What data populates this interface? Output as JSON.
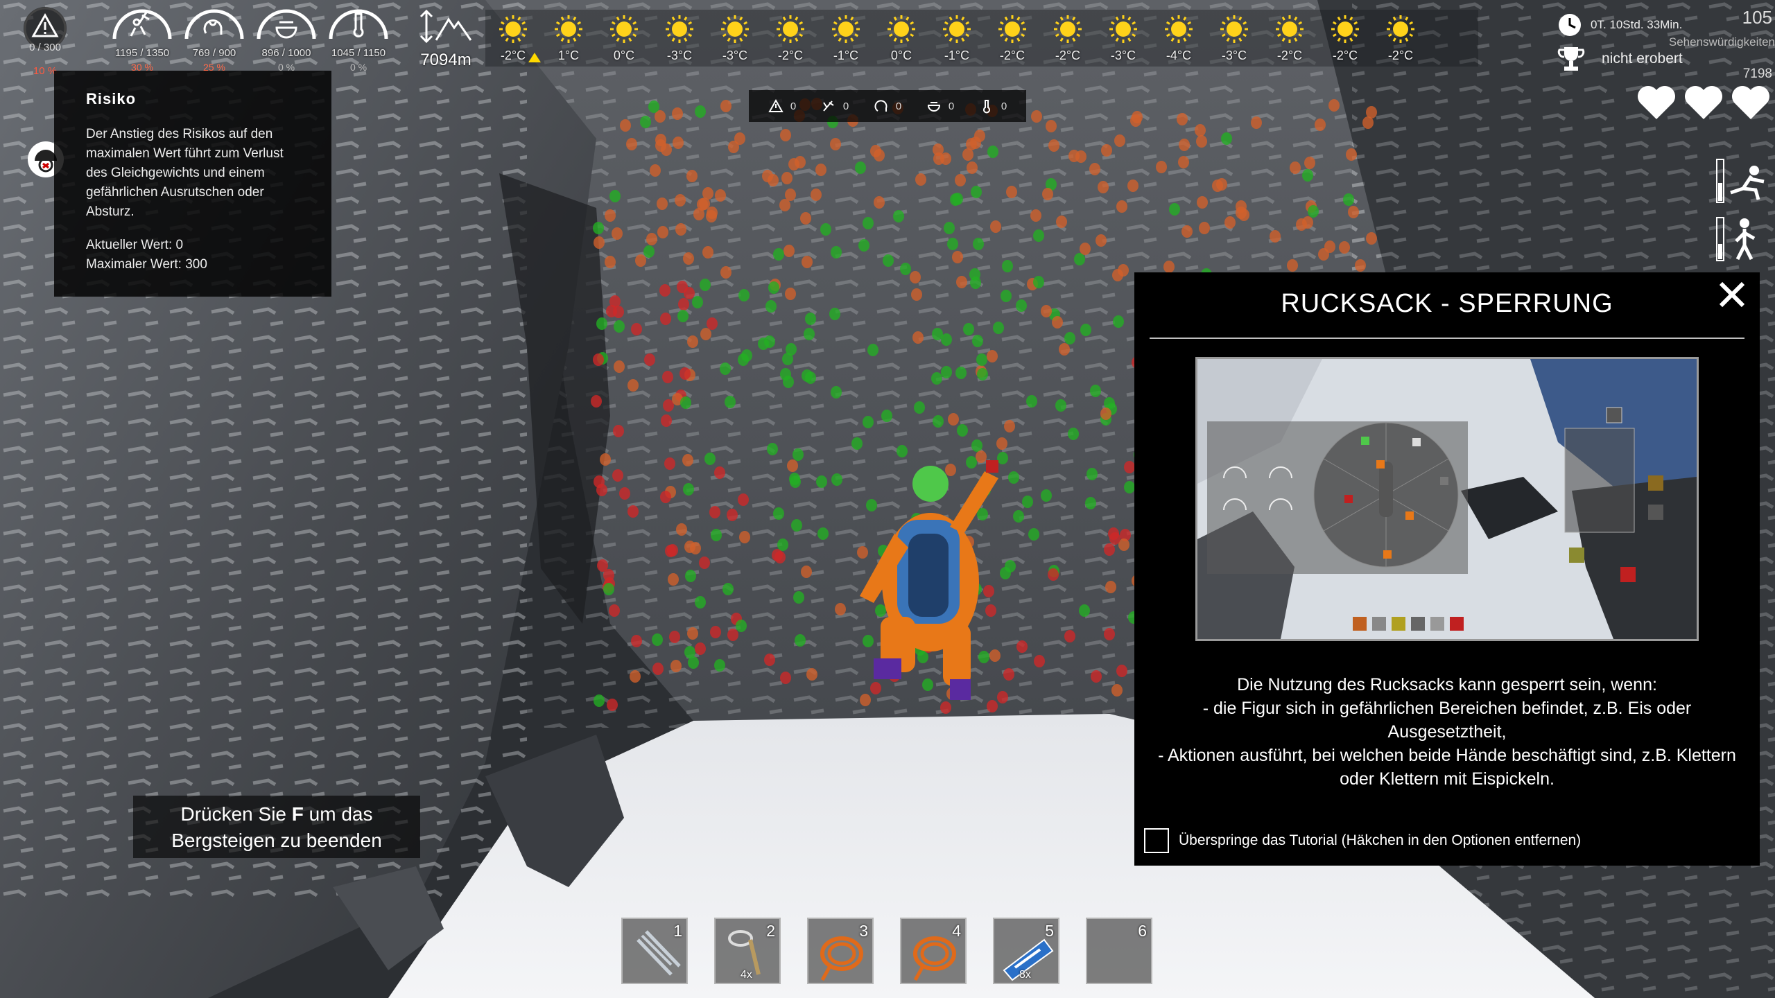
{
  "hud": {
    "risk": {
      "value": "0 / 300",
      "percent": "10 %"
    },
    "stats": [
      {
        "name": "energy-stat",
        "value": "1195 / 1350",
        "percent": "30 %",
        "percent_color": "red"
      },
      {
        "name": "mind-stat",
        "value": "769 / 900",
        "percent": "25 %",
        "percent_color": "red"
      },
      {
        "name": "food-stat",
        "value": "896 / 1000",
        "percent": "0 %",
        "percent_color": "grey"
      },
      {
        "name": "temperature-stat",
        "value": "1045 / 1150",
        "percent": "0 %",
        "percent_color": "grey"
      }
    ],
    "altitude": "7094m",
    "forecast": [
      "-2°C",
      "1°C",
      "0°C",
      "-3°C",
      "-3°C",
      "-2°C",
      "-1°C",
      "0°C",
      "-1°C",
      "-2°C",
      "-2°C",
      "-3°C",
      "-4°C",
      "-3°C",
      "-2°C",
      "-2°C",
      "-2°C"
    ],
    "time": "0T. 10Std. 33Min.",
    "conquest": "nicht erobert",
    "score_top": "105",
    "side_label": "Sehenswürdigkeiten",
    "score_bottom": "7198",
    "lives": 3
  },
  "counters": [
    {
      "icon": "warning-icon",
      "value": "0"
    },
    {
      "icon": "energy-icon",
      "value": "0"
    },
    {
      "icon": "mind-icon",
      "value": "0"
    },
    {
      "icon": "food-icon",
      "value": "0"
    },
    {
      "icon": "temperature-icon",
      "value": "0"
    }
  ],
  "risk_tooltip": {
    "title": "Risiko",
    "description": "Der Anstieg des Risikos auf den maximalen Wert führt zum Verlust des Gleichgewichts und einem gefährlichen Ausrutschen oder Absturz.",
    "current": "Aktueller Wert: 0",
    "maximum": "Maximaler Wert: 300"
  },
  "exit_hint": {
    "line1_pre": "Drücken Sie ",
    "key": "F",
    "line1_post": " um das",
    "line2": "Bergsteigen zu beenden"
  },
  "tutorial": {
    "title": "RUCKSACK - SPERRUNG",
    "body_lines": [
      "Die Nutzung des Rucksacks kann gesperrt sein, wenn:",
      "- die Figur sich in gefährlichen Bereichen befindet, z.B. Eis oder Ausgesetztheit,",
      "- Aktionen ausführt, bei welchen beide Hände beschäftigt sind, z.B. Klettern oder Klettern mit Eispickeln."
    ],
    "skip_label": "Überspringe das Tutorial (Häkchen in den Optionen entfernen)"
  },
  "hotbar": [
    {
      "num": "1",
      "item": "ladder-icon",
      "qty": ""
    },
    {
      "num": "2",
      "item": "carabiner-icon",
      "qty": "4x"
    },
    {
      "num": "3",
      "item": "rope-icon",
      "qty": ""
    },
    {
      "num": "4",
      "item": "rope-icon",
      "qty": ""
    },
    {
      "num": "5",
      "item": "energy-bar-icon",
      "qty": "8x"
    },
    {
      "num": "6",
      "item": "",
      "qty": ""
    }
  ],
  "colors": {
    "hold_good": "#22b022",
    "hold_bad": "#d02828",
    "hold_mid": "#d2602a",
    "risk_red": "#ff5a40",
    "sun": "#ffd21a"
  }
}
